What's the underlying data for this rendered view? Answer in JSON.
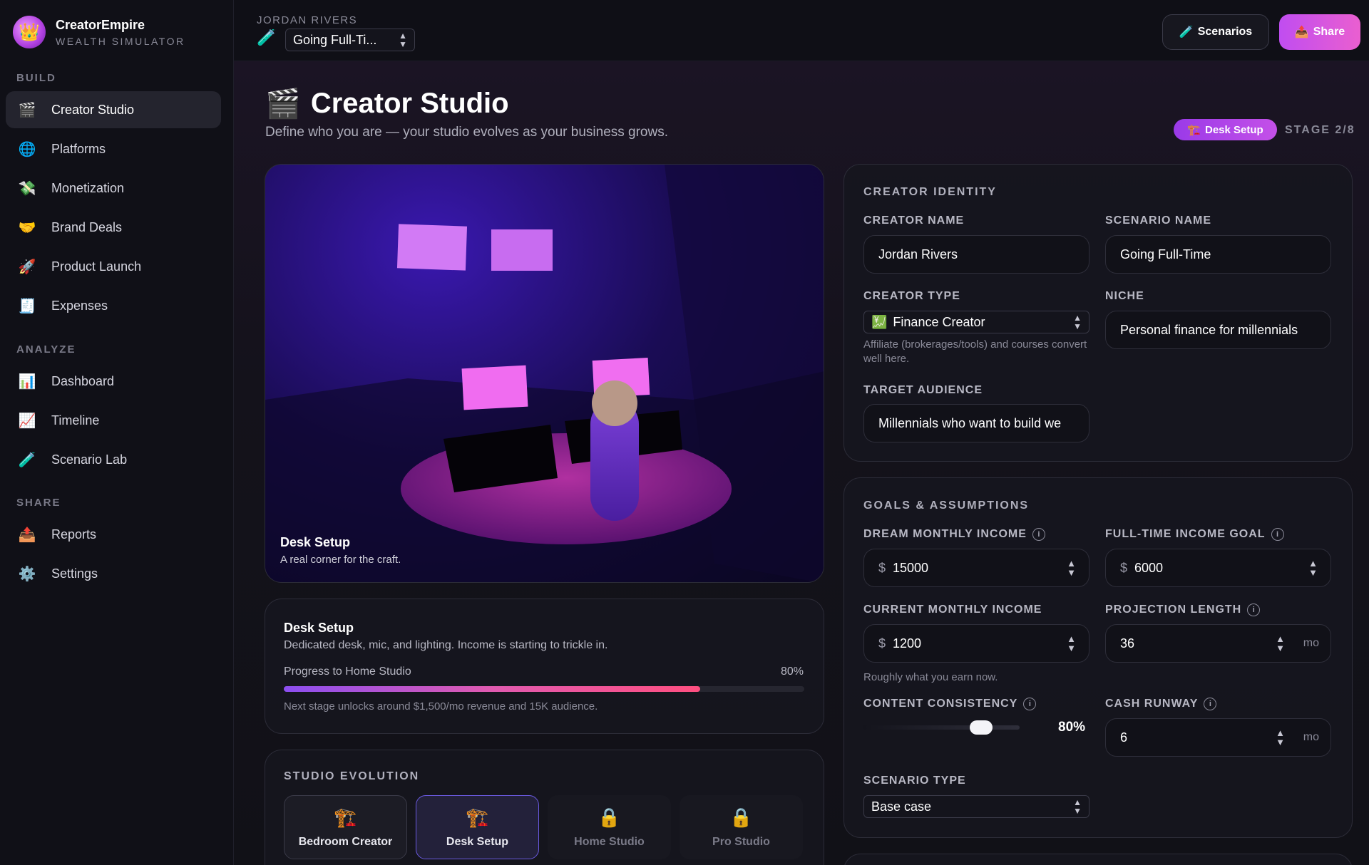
{
  "brand": {
    "name": "CreatorEmpire",
    "subtitle": "WEALTH SIMULATOR",
    "logo_icon": "👑"
  },
  "nav": {
    "sections": [
      {
        "label": "BUILD",
        "items": [
          {
            "label": "Creator Studio",
            "icon": "🎬",
            "active": true
          },
          {
            "label": "Platforms",
            "icon": "🌐"
          },
          {
            "label": "Monetization",
            "icon": "💸"
          },
          {
            "label": "Brand Deals",
            "icon": "🤝"
          },
          {
            "label": "Product Launch",
            "icon": "🚀"
          },
          {
            "label": "Expenses",
            "icon": "🧾"
          }
        ]
      },
      {
        "label": "ANALYZE",
        "items": [
          {
            "label": "Dashboard",
            "icon": "📊"
          },
          {
            "label": "Timeline",
            "icon": "📈"
          },
          {
            "label": "Scenario Lab",
            "icon": "🧪"
          }
        ]
      },
      {
        "label": "SHARE",
        "items": [
          {
            "label": "Reports",
            "icon": "📤"
          },
          {
            "label": "Settings",
            "icon": "⚙️"
          }
        ]
      }
    ]
  },
  "topbar": {
    "user": "JORDAN RIVERS",
    "scenario_selected": "Going Full-Ti...",
    "scenarios_button": "Scenarios",
    "share_button": "Share"
  },
  "page": {
    "icon": "🎬",
    "title": "Creator Studio",
    "subtitle": "Define who you are — your studio evolves as your business grows.",
    "stage_badge": "Desk Setup",
    "stage_count": "STAGE 2/8"
  },
  "scene": {
    "title": "Desk Setup",
    "subtitle": "A real corner for the craft."
  },
  "progress": {
    "title": "Desk Setup",
    "description": "Dedicated desk, mic, and lighting. Income is starting to trickle in.",
    "label": "Progress to Home Studio",
    "percent_text": "80%",
    "percent": 80,
    "note": "Next stage unlocks around $1,500/mo revenue and 15K audience."
  },
  "evolution": {
    "title": "STUDIO EVOLUTION",
    "stages": [
      {
        "label": "Bedroom Creator",
        "icon": "🏗️",
        "state": "unlocked"
      },
      {
        "label": "Desk Setup",
        "icon": "🏗️",
        "state": "current"
      },
      {
        "label": "Home Studio",
        "icon": "🔒",
        "state": "locked"
      },
      {
        "label": "Pro Studio",
        "icon": "🔒",
        "state": "locked"
      }
    ]
  },
  "identity": {
    "title": "CREATOR IDENTITY",
    "creator_name_label": "CREATOR NAME",
    "creator_name": "Jordan Rivers",
    "scenario_name_label": "SCENARIO NAME",
    "scenario_name": "Going Full-Time",
    "creator_type_label": "CREATOR TYPE",
    "creator_type": "Finance Creator",
    "creator_type_icon": "💹",
    "creator_type_help": "Affiliate (brokerages/tools) and courses convert well here.",
    "niche_label": "NICHE",
    "niche": "Personal finance for millennials",
    "target_audience_label": "TARGET AUDIENCE",
    "target_audience": "Millennials who want to build we"
  },
  "goals": {
    "title": "GOALS & ASSUMPTIONS",
    "dream_income_label": "DREAM MONTHLY INCOME",
    "dream_income": "15000",
    "fulltime_goal_label": "FULL-TIME INCOME GOAL",
    "fulltime_goal": "6000",
    "current_income_label": "CURRENT MONTHLY INCOME",
    "current_income": "1200",
    "current_income_help": "Roughly what you earn now.",
    "projection_label": "PROJECTION LENGTH",
    "projection": "36",
    "consistency_label": "CONTENT CONSISTENCY",
    "consistency_text": "80%",
    "consistency": 80,
    "runway_label": "CASH RUNWAY",
    "runway": "6",
    "scenario_type_label": "SCENARIO TYPE",
    "scenario_type": "Base case",
    "currency": "$",
    "unit_mo": "mo",
    "info": "i"
  },
  "colors": {
    "accent": "#c04df0",
    "progress_end": "#ff4f80",
    "background": "#0d0d14"
  }
}
